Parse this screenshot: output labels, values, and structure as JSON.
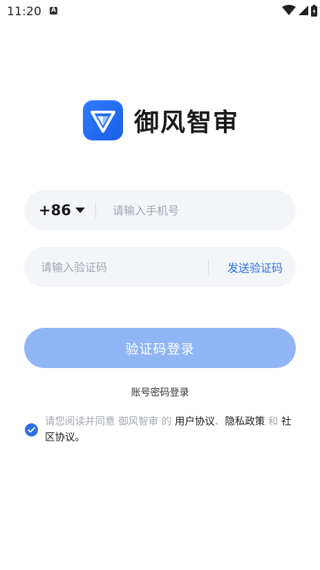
{
  "status_bar": {
    "time": "11:20",
    "a_icon_label": "A"
  },
  "app": {
    "name": "御风智审"
  },
  "phone_field": {
    "country_code": "+86",
    "value": "",
    "placeholder": "请输入手机号"
  },
  "code_field": {
    "value": "",
    "placeholder": "请输入验证码",
    "send_label": "发送验证码"
  },
  "login_button": {
    "label": "验证码登录"
  },
  "alt_login": {
    "label": "账号密码登录"
  },
  "agreement": {
    "checked": true,
    "prefix": "请您阅读并同意 御风智审 的 ",
    "user_agreement": "用户协议",
    "sep": "、",
    "privacy_policy": "隐私政策",
    "and": " 和 ",
    "community_agreement": "社区协议",
    "suffix": "。"
  },
  "colors": {
    "brand": "#2f6fe4",
    "button_disabled": "#8fb5f5",
    "field_bg": "#f3f5f9"
  }
}
